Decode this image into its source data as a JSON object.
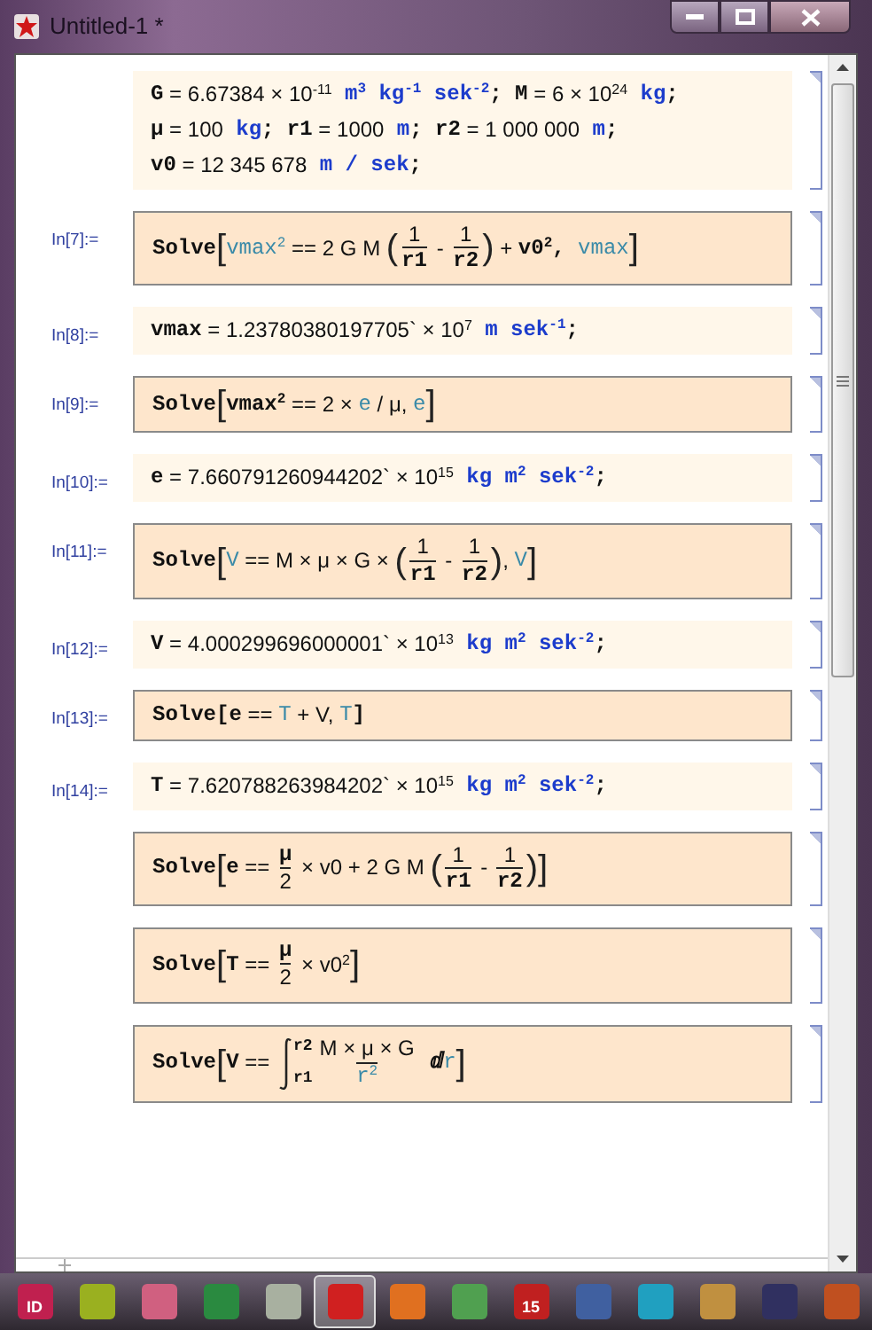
{
  "window": {
    "title": "Untitled-1 *"
  },
  "cells": [
    {
      "kind": "plain",
      "lines": [
        [
          {
            "kind": "code",
            "text": "G"
          },
          {
            "kind": "op",
            "text": " = "
          },
          {
            "kind": "num",
            "text": "6.67384"
          },
          {
            "kind": "op",
            "text": " × "
          },
          {
            "kind": "num",
            "text": "10$^{-11}$"
          },
          {
            "kind": "unit",
            "text": " m$^{3}$ kg$^{-1}$ sek$^{-2}$"
          },
          {
            "kind": "code",
            "text": "; M"
          },
          {
            "kind": "op",
            "text": " = "
          },
          {
            "kind": "num",
            "text": "6 × 10$^{24}$"
          },
          {
            "kind": "unit",
            "text": " kg"
          },
          {
            "kind": "code",
            "text": ";"
          }
        ],
        [
          {
            "kind": "code",
            "text": "μ"
          },
          {
            "kind": "op",
            "text": " = "
          },
          {
            "kind": "num",
            "text": "100"
          },
          {
            "kind": "unit",
            "text": " kg"
          },
          {
            "kind": "code",
            "text": "; r1"
          },
          {
            "kind": "op",
            "text": " = "
          },
          {
            "kind": "num",
            "text": "1000"
          },
          {
            "kind": "unit",
            "text": " m"
          },
          {
            "kind": "code",
            "text": "; r2"
          },
          {
            "kind": "op",
            "text": " = "
          },
          {
            "kind": "num",
            "text": "1 000 000"
          },
          {
            "kind": "unit",
            "text": " m"
          },
          {
            "kind": "code",
            "text": ";"
          }
        ],
        [
          {
            "kind": "code",
            "text": "v0"
          },
          {
            "kind": "op",
            "text": " = "
          },
          {
            "kind": "num",
            "text": "12 345 678"
          },
          {
            "kind": "unit",
            "text": " m / sek"
          },
          {
            "kind": "code",
            "text": ";"
          }
        ]
      ]
    },
    {
      "kind": "boxed",
      "label": "In[7]:=",
      "lines": [
        [
          {
            "kind": "code",
            "text": "Solve"
          },
          {
            "kind": "bracket",
            "text": "["
          },
          {
            "kind": "free",
            "text": "vmax$^{2}$"
          },
          {
            "kind": "op",
            "text": " == 2 G M "
          },
          {
            "kind": "bracket",
            "text": "("
          },
          {
            "kind": "frac",
            "num": [
              {
                "kind": "num",
                "text": "1"
              }
            ],
            "den": [
              {
                "kind": "code",
                "text": "r1"
              }
            ]
          },
          {
            "kind": "op",
            "text": " - "
          },
          {
            "kind": "frac",
            "num": [
              {
                "kind": "num",
                "text": "1"
              }
            ],
            "den": [
              {
                "kind": "code",
                "text": "r2"
              }
            ]
          },
          {
            "kind": "bracket",
            "text": ")"
          },
          {
            "kind": "op",
            "text": " + "
          },
          {
            "kind": "code",
            "text": "v0$^{2}$, "
          },
          {
            "kind": "free",
            "text": "vmax"
          },
          {
            "kind": "bracket",
            "text": "]"
          }
        ]
      ]
    },
    {
      "kind": "plain",
      "label": "In[8]:=",
      "lines": [
        [
          {
            "kind": "code",
            "text": "vmax"
          },
          {
            "kind": "op",
            "text": " = "
          },
          {
            "kind": "num",
            "text": "1.23780380197705` × 10$^{7}$"
          },
          {
            "kind": "unit",
            "text": " m sek$^{-1}$"
          },
          {
            "kind": "code",
            "text": ";"
          }
        ]
      ]
    },
    {
      "kind": "boxed",
      "label": "In[9]:=",
      "lines": [
        [
          {
            "kind": "code",
            "text": "Solve"
          },
          {
            "kind": "bracket",
            "text": "["
          },
          {
            "kind": "code",
            "text": "vmax$^{2}$"
          },
          {
            "kind": "op",
            "text": " == 2 × "
          },
          {
            "kind": "free",
            "text": "e"
          },
          {
            "kind": "op",
            "text": " / μ, "
          },
          {
            "kind": "free",
            "text": "e"
          },
          {
            "kind": "bracket",
            "text": "]"
          }
        ]
      ]
    },
    {
      "kind": "plain",
      "label": "In[10]:=",
      "lines": [
        [
          {
            "kind": "code",
            "text": "e"
          },
          {
            "kind": "op",
            "text": " = "
          },
          {
            "kind": "num",
            "text": "7.660791260944202` × 10$^{15}$"
          },
          {
            "kind": "unit",
            "text": " kg m$^{2}$ sek$^{-2}$"
          },
          {
            "kind": "code",
            "text": ";"
          }
        ]
      ]
    },
    {
      "kind": "boxed",
      "label": "In[11]:=",
      "lines": [
        [
          {
            "kind": "code",
            "text": "Solve"
          },
          {
            "kind": "bracket",
            "text": "["
          },
          {
            "kind": "free",
            "text": "V"
          },
          {
            "kind": "op",
            "text": " == M × μ × G × "
          },
          {
            "kind": "bracket",
            "text": "("
          },
          {
            "kind": "frac",
            "num": [
              {
                "kind": "num",
                "text": "1"
              }
            ],
            "den": [
              {
                "kind": "code",
                "text": "r1"
              }
            ]
          },
          {
            "kind": "op",
            "text": " - "
          },
          {
            "kind": "frac",
            "num": [
              {
                "kind": "num",
                "text": "1"
              }
            ],
            "den": [
              {
                "kind": "code",
                "text": "r2"
              }
            ]
          },
          {
            "kind": "bracket",
            "text": ")"
          },
          {
            "kind": "op",
            "text": ", "
          },
          {
            "kind": "free",
            "text": "V"
          },
          {
            "kind": "bracket",
            "text": "]"
          }
        ]
      ]
    },
    {
      "kind": "plain",
      "label": "In[12]:=",
      "lines": [
        [
          {
            "kind": "code",
            "text": "V"
          },
          {
            "kind": "op",
            "text": " = "
          },
          {
            "kind": "num",
            "text": "4.000299696000001` × 10$^{13}$"
          },
          {
            "kind": "unit",
            "text": " kg m$^{2}$ sek$^{-2}$"
          },
          {
            "kind": "code",
            "text": ";"
          }
        ]
      ]
    },
    {
      "kind": "boxed",
      "label": "In[13]:=",
      "lines": [
        [
          {
            "kind": "code",
            "text": "Solve[e"
          },
          {
            "kind": "op",
            "text": " == "
          },
          {
            "kind": "free",
            "text": "T"
          },
          {
            "kind": "op",
            "text": " + V, "
          },
          {
            "kind": "free",
            "text": "T"
          },
          {
            "kind": "code",
            "text": "]"
          }
        ]
      ]
    },
    {
      "kind": "plain",
      "label": "In[14]:=",
      "lines": [
        [
          {
            "kind": "code",
            "text": "T"
          },
          {
            "kind": "op",
            "text": " = "
          },
          {
            "kind": "num",
            "text": "7.620788263984202` × 10$^{15}$"
          },
          {
            "kind": "unit",
            "text": " kg m$^{2}$ sek$^{-2}$"
          },
          {
            "kind": "code",
            "text": ";"
          }
        ]
      ]
    },
    {
      "kind": "boxed",
      "lines": [
        [
          {
            "kind": "code",
            "text": "Solve"
          },
          {
            "kind": "bracket",
            "text": "["
          },
          {
            "kind": "code",
            "text": "e"
          },
          {
            "kind": "op",
            "text": " == "
          },
          {
            "kind": "frac",
            "num": [
              {
                "kind": "code",
                "text": "μ"
              }
            ],
            "den": [
              {
                "kind": "num",
                "text": "2"
              }
            ]
          },
          {
            "kind": "op",
            "text": " × v0 + 2 G M "
          },
          {
            "kind": "bracket",
            "text": "("
          },
          {
            "kind": "frac",
            "num": [
              {
                "kind": "num",
                "text": "1"
              }
            ],
            "den": [
              {
                "kind": "code",
                "text": "r1"
              }
            ]
          },
          {
            "kind": "op",
            "text": " - "
          },
          {
            "kind": "frac",
            "num": [
              {
                "kind": "num",
                "text": "1"
              }
            ],
            "den": [
              {
                "kind": "code",
                "text": "r2"
              }
            ]
          },
          {
            "kind": "bracket",
            "text": ")"
          },
          {
            "kind": "bracket",
            "text": "]"
          }
        ]
      ]
    },
    {
      "kind": "boxed",
      "lines": [
        [
          {
            "kind": "code",
            "text": "Solve"
          },
          {
            "kind": "bracket",
            "text": "["
          },
          {
            "kind": "code",
            "text": "T"
          },
          {
            "kind": "op",
            "text": " == "
          },
          {
            "kind": "frac",
            "num": [
              {
                "kind": "code",
                "text": "μ"
              }
            ],
            "den": [
              {
                "kind": "num",
                "text": "2"
              }
            ]
          },
          {
            "kind": "op",
            "text": " × v0$^{2}$"
          },
          {
            "kind": "bracket",
            "text": "]"
          }
        ]
      ]
    },
    {
      "kind": "boxed",
      "lines": [
        [
          {
            "kind": "code",
            "text": "Solve"
          },
          {
            "kind": "bracket",
            "text": "["
          },
          {
            "kind": "code",
            "text": "V"
          },
          {
            "kind": "op",
            "text": " == "
          },
          {
            "kind": "integral",
            "upper": "r2",
            "lower": "r1"
          },
          {
            "kind": "frac",
            "num": [
              {
                "kind": "op",
                "text": "M × μ × G"
              }
            ],
            "den": [
              {
                "kind": "free",
                "text": "r$^{2}$"
              }
            ]
          },
          {
            "kind": "code",
            "text": " ⅆ"
          },
          {
            "kind": "free",
            "text": "r"
          },
          {
            "kind": "bracket",
            "text": "]"
          }
        ]
      ]
    }
  ],
  "taskbar": [
    {
      "color": "#c0204f",
      "text": "ID",
      "selected": false
    },
    {
      "color": "#9ab020",
      "selected": false
    },
    {
      "color": "#d06080",
      "selected": false
    },
    {
      "color": "#2a8a40",
      "selected": false
    },
    {
      "color": "#a8b0a0",
      "selected": false
    },
    {
      "color": "#d02020",
      "selected": true
    },
    {
      "color": "#e07020",
      "selected": false
    },
    {
      "color": "#50a050",
      "selected": false
    },
    {
      "color": "#c02020",
      "text": "15",
      "selected": false
    },
    {
      "color": "#4060a0",
      "selected": false
    },
    {
      "color": "#20a0c0",
      "selected": false
    },
    {
      "color": "#c09040",
      "selected": false
    },
    {
      "color": "#303060",
      "selected": false
    },
    {
      "color": "#c05020",
      "selected": false
    }
  ]
}
